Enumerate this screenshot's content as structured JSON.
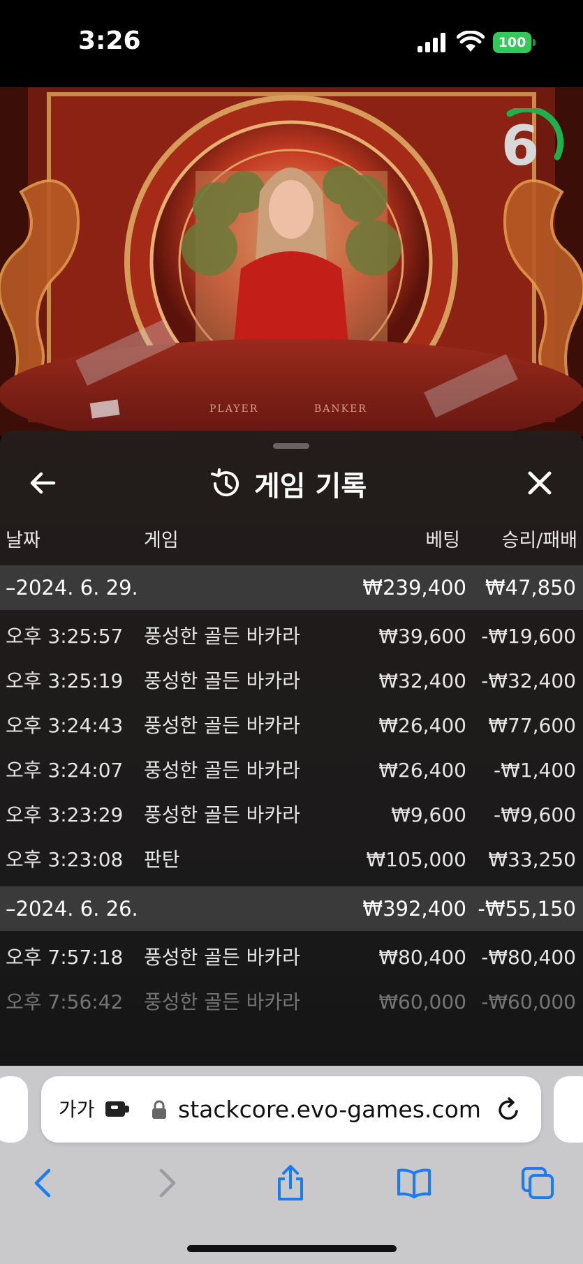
{
  "status_bar": {
    "time": "3:26",
    "battery": "100",
    "icons": [
      "signal-icon",
      "wifi-icon",
      "battery-icon"
    ]
  },
  "video": {
    "countdown": "6",
    "table_labels": {
      "player": "PLAYER",
      "banker": "BANKER"
    },
    "timer_color": "#1fb04c"
  },
  "panel": {
    "title": "게임 기록",
    "icons": [
      "back-arrow-icon",
      "history-icon",
      "close-icon"
    ],
    "columns": {
      "date": "날짜",
      "game": "게임",
      "bet": "베팅",
      "win_loss": "승리/패배"
    },
    "groups": [
      {
        "date": "–2024. 6. 29.",
        "bet": "₩239,400",
        "win_loss": "₩47,850",
        "rows": [
          {
            "time": "오후 3:25:57",
            "game": "풍성한 골든 바카라",
            "bet": "₩39,600",
            "win_loss": "-₩19,600"
          },
          {
            "time": "오후 3:25:19",
            "game": "풍성한 골든 바카라",
            "bet": "₩32,400",
            "win_loss": "-₩32,400"
          },
          {
            "time": "오후 3:24:43",
            "game": "풍성한 골든 바카라",
            "bet": "₩26,400",
            "win_loss": "₩77,600"
          },
          {
            "time": "오후 3:24:07",
            "game": "풍성한 골든 바카라",
            "bet": "₩26,400",
            "win_loss": "-₩1,400"
          },
          {
            "time": "오후 3:23:29",
            "game": "풍성한 골든 바카라",
            "bet": "₩9,600",
            "win_loss": "-₩9,600"
          },
          {
            "time": "오후 3:23:08",
            "game": "판탄",
            "bet": "₩105,000",
            "win_loss": "₩33,250"
          }
        ]
      },
      {
        "date": "–2024. 6. 26.",
        "bet": "₩392,400",
        "win_loss": "-₩55,150",
        "rows": [
          {
            "time": "오후 7:57:18",
            "game": "풍성한 골든 바카라",
            "bet": "₩80,400",
            "win_loss": "-₩80,400"
          },
          {
            "time": "오후 7:56:42",
            "game": "풍성한 골든 바카라",
            "bet": "₩60,000",
            "win_loss": "-₩60,000"
          }
        ]
      }
    ]
  },
  "browser": {
    "text_size_button": "가가",
    "url": "stackcore.evo-games.com",
    "icons": [
      "extension-icon",
      "lock-icon",
      "reload-icon",
      "back-icon",
      "forward-icon",
      "share-icon",
      "bookmarks-icon",
      "tabs-icon"
    ],
    "accent": "#1a7cf5"
  }
}
